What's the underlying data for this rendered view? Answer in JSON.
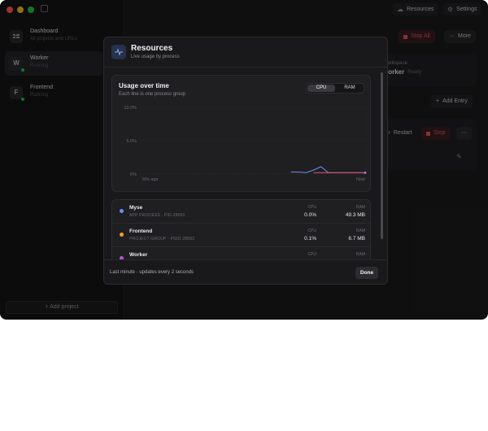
{
  "titlebar": {
    "resources_label": "Resources",
    "settings_label": "Settings"
  },
  "sidebar": {
    "items": [
      {
        "badge": "",
        "title": "Dashboard",
        "subtitle": "All projects and URLs"
      },
      {
        "badge": "W",
        "title": "Worker",
        "subtitle": "Running"
      },
      {
        "badge": "F",
        "title": "Frontend",
        "subtitle": "Running"
      }
    ],
    "add_project_label": "Add project"
  },
  "background": {
    "stop_all_label": "Stop All",
    "more_label": "More",
    "workspace_label": "Workspace",
    "workspace_value": "worker",
    "workspace_status": "Ready",
    "add_entry_label": "Add Entry",
    "restart_label": "Restart",
    "stop_label": "Stop"
  },
  "modal": {
    "title": "Resources",
    "subtitle": "Live usage by process",
    "chart_title": "Usage over time",
    "chart_subtitle": "Each line is one process group",
    "toggle": {
      "cpu": "CPU",
      "ram": "RAM"
    },
    "footer_text": "Last minute · updates every 2 seconds",
    "done_label": "Done",
    "processes": [
      {
        "name": "Myse",
        "meta": "APP PROCESS · PID 28650",
        "cpu_label": "CPU",
        "cpu": "0.0%",
        "ram_label": "RAM",
        "ram": "49.3 MB",
        "color": "#6e8cf0"
      },
      {
        "name": "Frontend",
        "meta": "PROJECT GROUP · PGID 28683",
        "cpu_label": "CPU",
        "cpu": "0.1%",
        "ram_label": "RAM",
        "ram": "6.7 MB",
        "color": "#f59e2b"
      },
      {
        "name": "Worker",
        "meta": "",
        "cpu_label": "CPU",
        "cpu": "",
        "ram_label": "RAM",
        "ram": "",
        "color": "#b25ad6"
      }
    ]
  },
  "chart_data": {
    "type": "line",
    "title": "Usage over time",
    "subtitle": "Each line is one process group",
    "xlabel": "",
    "ylabel": "",
    "x_tick_labels": [
      "60s ago",
      "Now"
    ],
    "y_tick_labels": [
      "10.0%",
      "5.0%",
      "0%"
    ],
    "ylim": [
      0,
      10
    ],
    "grid": true,
    "series": [
      {
        "color": "#6e8cf0",
        "values": [
          0.0,
          0.0,
          0.0,
          0.0,
          0.0,
          0.0,
          0.0,
          0.0,
          0.0,
          0.0,
          0.0,
          0.0,
          0.0,
          0.0,
          0.0,
          0.0,
          0.0,
          0.0,
          0.0,
          0.0,
          0.3,
          0.3,
          0.2,
          0.6,
          1.1,
          0.2,
          0.2,
          0.2,
          0.2,
          0.2,
          0.2
        ]
      },
      {
        "color": "#e84f6d",
        "values": [
          null,
          null,
          null,
          null,
          null,
          null,
          null,
          null,
          null,
          null,
          null,
          null,
          null,
          null,
          null,
          null,
          null,
          null,
          null,
          null,
          null,
          null,
          null,
          0.2,
          0.2,
          0.2,
          0.2,
          0.2,
          0.2,
          0.2,
          0.2
        ]
      }
    ]
  }
}
